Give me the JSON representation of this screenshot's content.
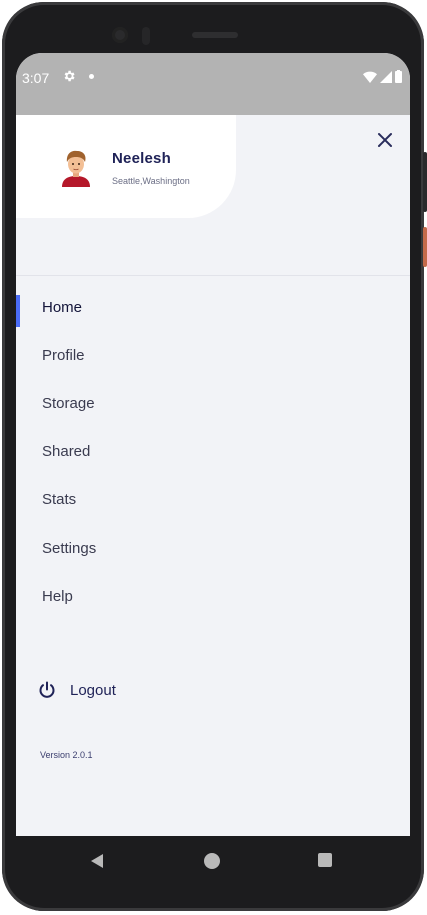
{
  "status_bar": {
    "time": "3:07",
    "icons": [
      "gear-icon",
      "notification-dot-icon",
      "wifi-icon",
      "signal-icon",
      "battery-icon"
    ]
  },
  "drawer": {
    "user": {
      "name": "Neelesh",
      "location": "Seattle,Washington"
    },
    "close_icon": "close-icon",
    "menu": [
      {
        "label": "Home",
        "active": true
      },
      {
        "label": "Profile",
        "active": false
      },
      {
        "label": "Storage",
        "active": false
      },
      {
        "label": "Shared",
        "active": false
      },
      {
        "label": "Stats",
        "active": false
      },
      {
        "label": "Settings",
        "active": false
      },
      {
        "label": "Help",
        "active": false
      }
    ],
    "logout": {
      "label": "Logout",
      "icon": "power-icon"
    },
    "version": "Version 2.0.1"
  },
  "navigation_bar": {
    "icons": [
      "back-icon",
      "home-icon",
      "recents-icon"
    ]
  },
  "colors": {
    "accent": "#4a6cf7",
    "name_text": "#1f2257",
    "background": "#f2f3f7",
    "status_bar": "#b3b3b3"
  }
}
